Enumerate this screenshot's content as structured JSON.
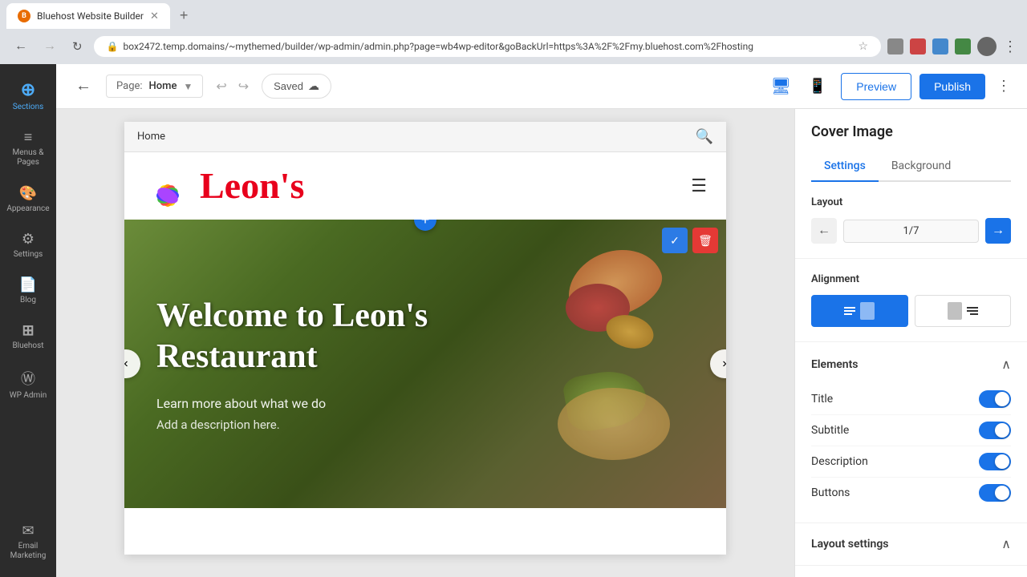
{
  "browser": {
    "tab_title": "Bluehost Website Builder",
    "tab_favicon": "B",
    "address": "box2472.temp.domains/~mythemed/builder/wp-admin/admin.php?page=wb4wp-editor&goBackUrl=https%3A%2F%2Fmy.bluehost.com%2Fhosting",
    "new_tab_label": "+"
  },
  "toolbar": {
    "back_label": "←",
    "page_label": "Page:",
    "page_name": "Home",
    "undo_label": "↩",
    "redo_label": "↪",
    "saved_label": "Saved",
    "preview_label": "Preview",
    "publish_label": "Publish",
    "more_label": "⋮"
  },
  "sidebar": {
    "items": [
      {
        "id": "sections",
        "label": "Sections",
        "icon": "＋"
      },
      {
        "id": "menus",
        "label": "Menus &\nPages",
        "icon": "☰"
      },
      {
        "id": "appearance",
        "label": "Appearance",
        "icon": "🎨"
      },
      {
        "id": "settings",
        "label": "Settings",
        "icon": "⚙"
      },
      {
        "id": "blog",
        "label": "Blog",
        "icon": "📝"
      },
      {
        "id": "bluehost",
        "label": "Bluehost",
        "icon": "B"
      },
      {
        "id": "wpadmin",
        "label": "WP Admin",
        "icon": "W"
      },
      {
        "id": "email",
        "label": "Email\nMarketing",
        "icon": "✉"
      }
    ]
  },
  "canvas": {
    "breadcrumb": "Home",
    "logo_text": "Leon's",
    "hero_title": "Welcome to Leon's Restaurant",
    "hero_subtitle": "Learn more about what we do",
    "hero_desc": "Add a description here."
  },
  "right_panel": {
    "title": "Cover Image",
    "tabs": [
      {
        "id": "settings",
        "label": "Settings",
        "active": true
      },
      {
        "id": "background",
        "label": "Background",
        "active": false
      }
    ],
    "layout": {
      "label": "Layout",
      "prev_label": "←",
      "next_label": "→",
      "value": "1/7"
    },
    "alignment": {
      "label": "Alignment",
      "options": [
        {
          "id": "left-text",
          "icon": "▤",
          "active": true
        },
        {
          "id": "right-text",
          "icon": "▧",
          "active": false
        }
      ]
    },
    "elements": {
      "label": "Elements",
      "items": [
        {
          "id": "title",
          "label": "Title",
          "enabled": true
        },
        {
          "id": "subtitle",
          "label": "Subtitle",
          "enabled": true
        },
        {
          "id": "description",
          "label": "Description",
          "enabled": true
        },
        {
          "id": "buttons",
          "label": "Buttons",
          "enabled": true
        }
      ]
    },
    "layout_settings": {
      "label": "Layout settings"
    }
  },
  "colors": {
    "blue": "#1a73e8",
    "red": "#e53935",
    "hero_bg_dark": "#4a5a2a",
    "text_white": "#ffffff"
  }
}
